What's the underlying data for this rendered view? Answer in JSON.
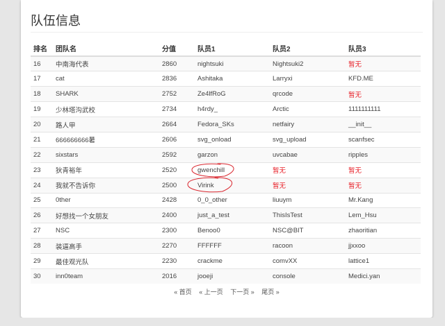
{
  "page": {
    "title": "队伍信息"
  },
  "table": {
    "headers": {
      "rank": "排名",
      "team": "团队名",
      "score": "分值",
      "member1": "队员1",
      "member2": "队员2",
      "member3": "队员3"
    },
    "rows": [
      {
        "rank": "16",
        "team": "中南海代表",
        "score": "2860",
        "m1": "nightsuki",
        "m2": "Nightsuki2",
        "m3": "暂无"
      },
      {
        "rank": "17",
        "team": "cat",
        "score": "2836",
        "m1": "Ashitaka",
        "m2": "Larryxi",
        "m3": "KFD.ME"
      },
      {
        "rank": "18",
        "team": "SHARK",
        "score": "2752",
        "m1": "Ze4lfRoG",
        "m2": "qrcode",
        "m3": "暂无"
      },
      {
        "rank": "19",
        "team": "少林塔沟武校",
        "score": "2734",
        "m1": "h4rdy_",
        "m2": "Arctic",
        "m3": "1111111111"
      },
      {
        "rank": "20",
        "team": "路人甲",
        "score": "2664",
        "m1": "Fedora_SKs",
        "m2": "netfairy",
        "m3": "__init__"
      },
      {
        "rank": "21",
        "team": "666666666暑",
        "score": "2606",
        "m1": "svg_onload",
        "m2": "svg_upload",
        "m3": "scanfsec"
      },
      {
        "rank": "22",
        "team": "sixstars",
        "score": "2592",
        "m1": "garzon",
        "m2": "uvcabae",
        "m3": "ripples"
      },
      {
        "rank": "23",
        "team": "狄青裕年",
        "score": "2520",
        "m1": "gwenchill",
        "m2": "暂无",
        "m3": "暂无"
      },
      {
        "rank": "24",
        "team": "我就不告诉你",
        "score": "2500",
        "m1": "Virink",
        "m2": "暂无",
        "m3": "暂无"
      },
      {
        "rank": "25",
        "team": "0ther",
        "score": "2428",
        "m1": "0_0_other",
        "m2": "liuuym",
        "m3": "Mr.Kang"
      },
      {
        "rank": "26",
        "team": "好想找一个女朋友",
        "score": "2400",
        "m1": "just_a_test",
        "m2": "ThisIsTest",
        "m3": "Lem_Hsu"
      },
      {
        "rank": "27",
        "team": "NSC",
        "score": "2300",
        "m1": "Benoo0",
        "m2": "NSC@BIT",
        "m3": "zhaoritian"
      },
      {
        "rank": "28",
        "team": "装逼高手",
        "score": "2270",
        "m1": "FFFFFF",
        "m2": "racoon",
        "m3": "jjxxoo"
      },
      {
        "rank": "29",
        "team": "最佳观光队",
        "score": "2230",
        "m1": "crackme",
        "m2": "comvXX",
        "m3": "lattice1"
      },
      {
        "rank": "30",
        "team": "inn0team",
        "score": "2016",
        "m1": "jooeji",
        "m2": "console",
        "m3": "Medici.yan"
      }
    ]
  },
  "pager": {
    "first": "« 首页",
    "prev": "« 上一页",
    "next": "下一页 »",
    "last": "尾页 »"
  },
  "colors": {
    "empty_value": "#e8232b",
    "annotation": "#d9262e"
  }
}
